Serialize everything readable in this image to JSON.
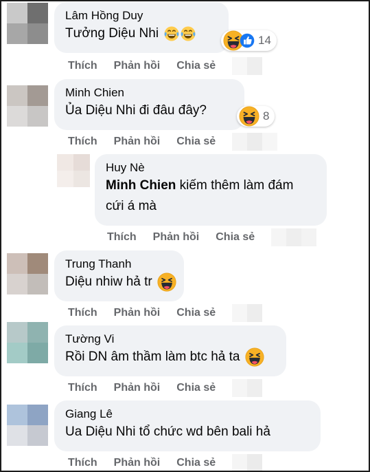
{
  "actions": {
    "like": "Thích",
    "reply": "Phản hồi",
    "share": "Chia sẻ"
  },
  "comments": [
    {
      "author": "Lâm Hồng Duy",
      "text": "Tưởng Diệu Nhi",
      "reactions": "14",
      "reaction_icons": [
        "haha-icon",
        "like-icon"
      ],
      "inline_emoji": [
        "laughing-tears-emoji",
        "laughing-tears-emoji"
      ]
    },
    {
      "author": "Minh Chien",
      "text": "Ủa Diệu Nhi đi đâu đây?",
      "reactions": "8",
      "reaction_icons": [
        "haha-icon"
      ]
    },
    {
      "author": "Huy Nè",
      "mention": "Minh Chien",
      "text": " kiếm thêm làm đám cứi á mà",
      "is_reply": true
    },
    {
      "author": "Trung Thanh",
      "text": "Diệu nhiw hả tr",
      "reaction_icons": [
        "haha-icon"
      ]
    },
    {
      "author": "Tường Vi",
      "text": "Rồi DN âm thầm làm btc hả ta",
      "reaction_icons": [
        "haha-icon"
      ]
    },
    {
      "author": "Giang Lê",
      "text": "Ua Diệu Nhi tổ chức wd bên bali hả"
    }
  ],
  "colors": {
    "bubble": "#f0f2f5",
    "action_text": "#65676b",
    "haha_yellow": "#f7b125",
    "like_blue": "#1877f2"
  }
}
